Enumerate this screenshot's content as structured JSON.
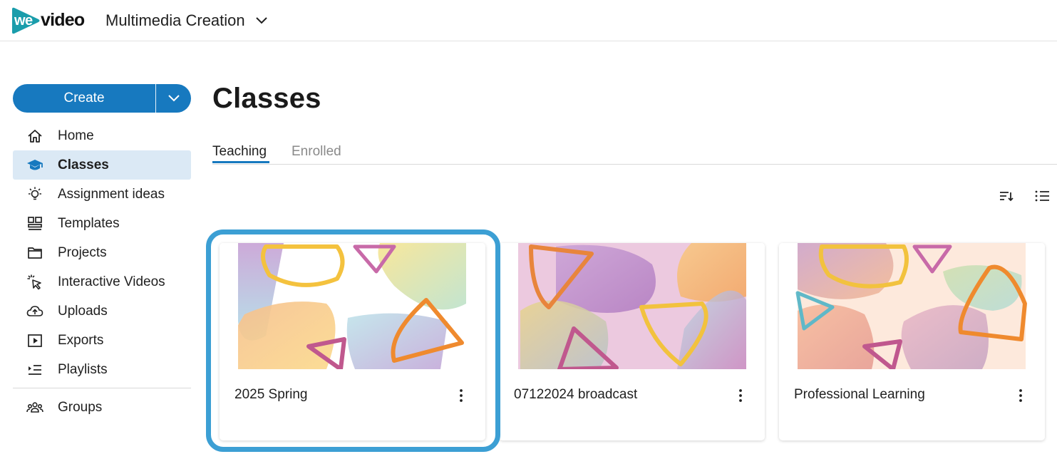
{
  "header": {
    "logo_we": "we",
    "logo_video": "video",
    "workspace_name": "Multimedia Creation",
    "workspace_icon": "chevron-down-icon"
  },
  "sidebar": {
    "create_label": "Create",
    "create_dropdown_icon": "chevron-down-icon",
    "items": [
      {
        "label": "Home",
        "icon": "home-icon",
        "active": false
      },
      {
        "label": "Classes",
        "icon": "graduation-cap-icon",
        "active": true
      },
      {
        "label": "Assignment ideas",
        "icon": "lightbulb-icon",
        "active": false
      },
      {
        "label": "Templates",
        "icon": "templates-icon",
        "active": false
      },
      {
        "label": "Projects",
        "icon": "folder-icon",
        "active": false
      },
      {
        "label": "Interactive Videos",
        "icon": "cursor-click-icon",
        "active": false
      },
      {
        "label": "Uploads",
        "icon": "cloud-upload-icon",
        "active": false
      },
      {
        "label": "Exports",
        "icon": "play-box-icon",
        "active": false
      },
      {
        "label": "Playlists",
        "icon": "playlist-icon",
        "active": false
      }
    ],
    "secondary_items": [
      {
        "label": "Groups",
        "icon": "group-icon"
      }
    ]
  },
  "main": {
    "title": "Classes",
    "tabs": [
      {
        "label": "Teaching",
        "active": true
      },
      {
        "label": "Enrolled",
        "active": false
      }
    ],
    "toolbar": {
      "sort_icon": "sort-icon",
      "list_view_icon": "list-view-icon"
    },
    "classes": [
      {
        "title": "2025 Spring",
        "selected": true
      },
      {
        "title": "07122024 broadcast",
        "selected": false
      },
      {
        "title": "Professional Learning",
        "selected": false
      }
    ]
  },
  "colors": {
    "brand_blue": "#1779bf",
    "active_nav_bg": "#dbe9f5",
    "focus_ring": "#3c9fd4",
    "logo_teal": "#1a9dab"
  }
}
